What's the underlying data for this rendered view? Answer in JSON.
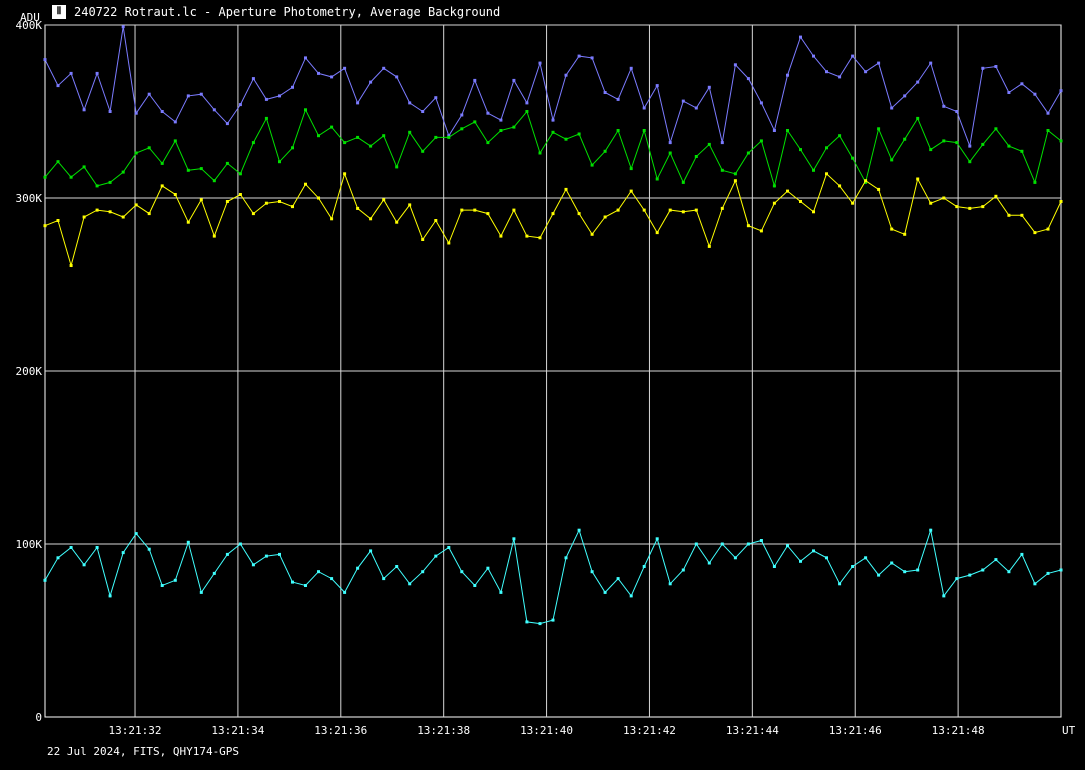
{
  "window": {
    "icon": "lightcurve-app-icon",
    "title": "240722 Rotraut.lc - Aperture Photometry, Average Background"
  },
  "footer": "22 Jul 2024, FITS, QHY174-GPS",
  "chart_data": {
    "type": "line",
    "ylabel": "ADU",
    "xlabel": "UT",
    "ylim": [
      0,
      400000
    ],
    "xlim": [
      "13:21:30.25",
      "13:21:50.00"
    ],
    "y_ticks": [
      0,
      100000,
      200000,
      300000,
      400000
    ],
    "y_tick_labels": [
      "0",
      "100K",
      "200K",
      "300K",
      "400K"
    ],
    "x_ticks": [
      "13:21:32",
      "13:21:34",
      "13:21:36",
      "13:21:38",
      "13:21:40",
      "13:21:42",
      "13:21:44",
      "13:21:46",
      "13:21:48"
    ],
    "x_tick_labels": [
      "13:21:32",
      "13:21:34",
      "13:21:36",
      "13:21:38",
      "13:21:40",
      "13:21:42",
      "13:21:44",
      "13:21:46",
      "13:21:48"
    ],
    "grid": true,
    "colors": {
      "background": "#000000",
      "grid": "#d8d8d8",
      "axes": "#ffffff"
    },
    "series": [
      {
        "color": "#7b7bff",
        "values": [
          380000,
          365000,
          372000,
          351000,
          372000,
          350000,
          399000,
          349000,
          360000,
          350000,
          344000,
          359000,
          360000,
          351000,
          343000,
          354000,
          369000,
          357000,
          359000,
          364000,
          381000,
          372000,
          370000,
          375000,
          355000,
          367000,
          375000,
          370000,
          355000,
          350000,
          358000,
          336000,
          348000,
          368000,
          349000,
          345000,
          368000,
          355000,
          378000,
          345000,
          371000,
          382000,
          381000,
          361000,
          357000,
          375000,
          352000,
          365000,
          332000,
          356000,
          352000,
          364000,
          332000,
          377000,
          369000,
          355000,
          339000,
          371000,
          393000,
          382000,
          373000,
          370000,
          382000,
          373000,
          378000,
          352000,
          359000,
          367000,
          378000,
          353000,
          350000,
          330000,
          375000,
          376000,
          361000,
          366000,
          360000,
          349000,
          362000
        ]
      },
      {
        "color": "#00e000",
        "values": [
          312000,
          321000,
          312000,
          318000,
          307000,
          309000,
          315000,
          326000,
          329000,
          320000,
          333000,
          316000,
          317000,
          310000,
          320000,
          314000,
          332000,
          346000,
          321000,
          329000,
          351000,
          336000,
          341000,
          332000,
          335000,
          330000,
          336000,
          318000,
          338000,
          327000,
          335000,
          335000,
          340000,
          344000,
          332000,
          339000,
          341000,
          350000,
          326000,
          338000,
          334000,
          337000,
          319000,
          327000,
          339000,
          317000,
          339000,
          311000,
          326000,
          309000,
          324000,
          331000,
          316000,
          314000,
          326000,
          333000,
          307000,
          339000,
          328000,
          316000,
          329000,
          336000,
          323000,
          309000,
          340000,
          322000,
          334000,
          346000,
          328000,
          333000,
          332000,
          321000,
          331000,
          340000,
          330000,
          327000,
          309000,
          339000,
          333000
        ]
      },
      {
        "color": "#ffff00",
        "values": [
          284000,
          287000,
          261000,
          289000,
          293000,
          292000,
          289000,
          296000,
          291000,
          307000,
          302000,
          286000,
          299000,
          278000,
          298000,
          302000,
          291000,
          297000,
          298000,
          295000,
          308000,
          300000,
          288000,
          314000,
          294000,
          288000,
          299000,
          286000,
          296000,
          276000,
          287000,
          274000,
          293000,
          293000,
          291000,
          278000,
          293000,
          278000,
          277000,
          291000,
          305000,
          291000,
          279000,
          289000,
          293000,
          304000,
          293000,
          280000,
          293000,
          292000,
          293000,
          272000,
          294000,
          310000,
          284000,
          281000,
          297000,
          304000,
          298000,
          292000,
          314000,
          307000,
          297000,
          310000,
          305000,
          282000,
          279000,
          311000,
          297000,
          300000,
          295000,
          294000,
          295000,
          301000,
          290000,
          290000,
          280000,
          282000,
          298000
        ]
      },
      {
        "color": "#40ffff",
        "values": [
          79000,
          92000,
          98000,
          88000,
          98000,
          70000,
          95000,
          106000,
          97000,
          76000,
          79000,
          101000,
          72000,
          83000,
          94000,
          100000,
          88000,
          93000,
          94000,
          78000,
          76000,
          84000,
          80000,
          72000,
          86000,
          96000,
          80000,
          87000,
          77000,
          84000,
          93000,
          98000,
          84000,
          76000,
          86000,
          72000,
          103000,
          55000,
          54000,
          56000,
          92000,
          108000,
          84000,
          72000,
          80000,
          70000,
          87000,
          103000,
          77000,
          85000,
          100000,
          89000,
          100000,
          92000,
          100000,
          102000,
          87000,
          99000,
          90000,
          96000,
          92000,
          77000,
          87000,
          92000,
          82000,
          89000,
          84000,
          85000,
          108000,
          70000,
          80000,
          82000,
          85000,
          91000,
          84000,
          94000,
          77000,
          83000,
          85000
        ]
      }
    ]
  }
}
